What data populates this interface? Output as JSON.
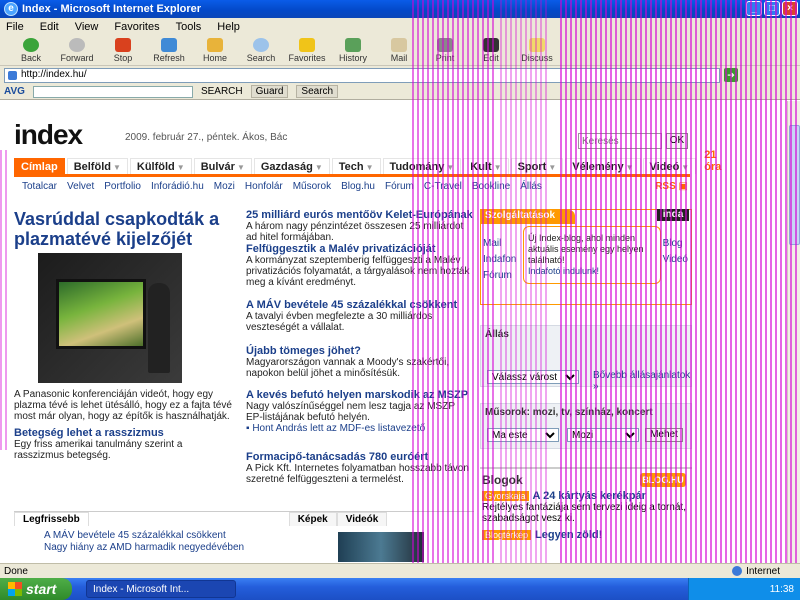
{
  "window": {
    "title": "Index - Microsoft Internet Explorer"
  },
  "menu": [
    "File",
    "Edit",
    "View",
    "Favorites",
    "Tools",
    "Help"
  ],
  "toolbar": [
    "Back",
    "Forward",
    "Stop",
    "Refresh",
    "Home",
    "Search",
    "Favorites",
    "History",
    "Mail",
    "Print",
    "Edit",
    "Discuss"
  ],
  "address": {
    "value": "http://index.hu/"
  },
  "avg": {
    "logo": "AVG",
    "search_label": "SEARCH",
    "items": [
      "Guard",
      "Search"
    ]
  },
  "site": {
    "logo": "index",
    "dateline": "2009. február 27., péntek. Ákos, Bác",
    "search_placeholder": "Keresés",
    "ok_label": "OK",
    "nav": [
      "Címlap",
      "Belföld",
      "Külföld",
      "Bulvár",
      "Gazdaság",
      "Tech",
      "Tudomány",
      "Kult",
      "Sport",
      "Vélemény",
      "Videó"
    ],
    "nav_right": "21 óra",
    "subnav": [
      "Totalcar",
      "Velvet",
      "Portfolio",
      "Inforádió.hu",
      "Mozi",
      "Hon­fo­lár",
      "Műsorok",
      "Blog.hu",
      "Fórum",
      "C-Travel",
      "Bookline",
      "Állás"
    ],
    "rss": "RSS",
    "lead": {
      "title": "Vasrúddal csapkodták a plazmatévé kijelzőjét",
      "text": "A Panasonic konferenciáján videót, hogy egy plazma tévé is lehet ütésálló, hogy ez a fajta tévé most már olyan, hogy az építők is használhatják.",
      "link": "Betegség lehet a rasszizmus",
      "link_text": "Egy friss amerikai tanulmány szerint a rasszizmus betegség."
    },
    "articles": [
      {
        "h": "25 milliárd eurós mentőöv Kelet-Európának",
        "t": "A három nagy pénzintézet összesen 25 milliárdot ad hitel formájában."
      },
      {
        "h": "Felfüggesztik a Malév privatizációját",
        "t": "A kormányzat szeptemberig felfüggeszti a Malév privatizációs folyamatát, a tárgyalások nem hozták meg a kívánt eredményt."
      },
      {
        "h": "A MÁV bevétele 45 százalékkal csökkent",
        "t": "A tavalyi évben megfelezte a 30 milliárdos veszteségét a vállalat."
      },
      {
        "h": "Újabb tömeges jöhet?",
        "t": "Magyarországon vannak a Moody's szakértői, napokon belül jöhet a minősítésük."
      },
      {
        "h": "A kevés befutó helyen marskodik az MSZP",
        "t": "Nagy valószínűséggel nem lesz tagja az MSZP EP-listájának befutó helyén.",
        "bullet": "Hont András lett az MDF-es listavezető"
      },
      {
        "h": "Formacipő-tanácsadás 780 euróért",
        "t": "A Pick Kft. Internetes folyamatban hosszabb távon szeretné felfüggeszteni a termelést."
      }
    ],
    "services": {
      "header": "Szolgáltatások",
      "links": [
        "Mail",
        "Indafon",
        "Fórum"
      ],
      "bubble": "Új Index-blog, ahol minden aktuális esemény egy helyen található!",
      "bubble_link": "Indafotó indulunk!",
      "side": [
        "Blog",
        "Videó"
      ],
      "inda": "inda"
    },
    "jobs": {
      "label": "Állás",
      "select": "Válassz várost",
      "link": "Bővebb állásajánlatok »"
    },
    "programs": {
      "label": "Műsorok: mozi, tv, színház, koncert",
      "select1": "Ma este",
      "select2": "Mozi",
      "button": "Mehet"
    },
    "blogs": {
      "title": "Blogok",
      "logo": "BLOG.HU",
      "items": [
        {
          "tag": "Gyorskaja",
          "h": "A 24 kártyás kerékpár",
          "t": "Rejtélyes fantáziája sem tervezi ideig a tornát, szabadságot vesz ki."
        },
        {
          "tag": "Blogtérkép",
          "h": "Legyen zöld!",
          "t": ""
        }
      ]
    },
    "bottom": {
      "tabs": [
        "Legfrissebb",
        "Képek",
        "Videók"
      ],
      "items": [
        "A MÁV bevétele 45 százalékkal csökkent",
        "Nagy hiány az AMD harmadik negyedévében"
      ]
    }
  },
  "status": {
    "text": "Done",
    "zone": "Internet"
  },
  "taskbar": {
    "start": "start",
    "task": "Index - Microsoft Int...",
    "tray_item": "Internet",
    "time": "11:38"
  }
}
